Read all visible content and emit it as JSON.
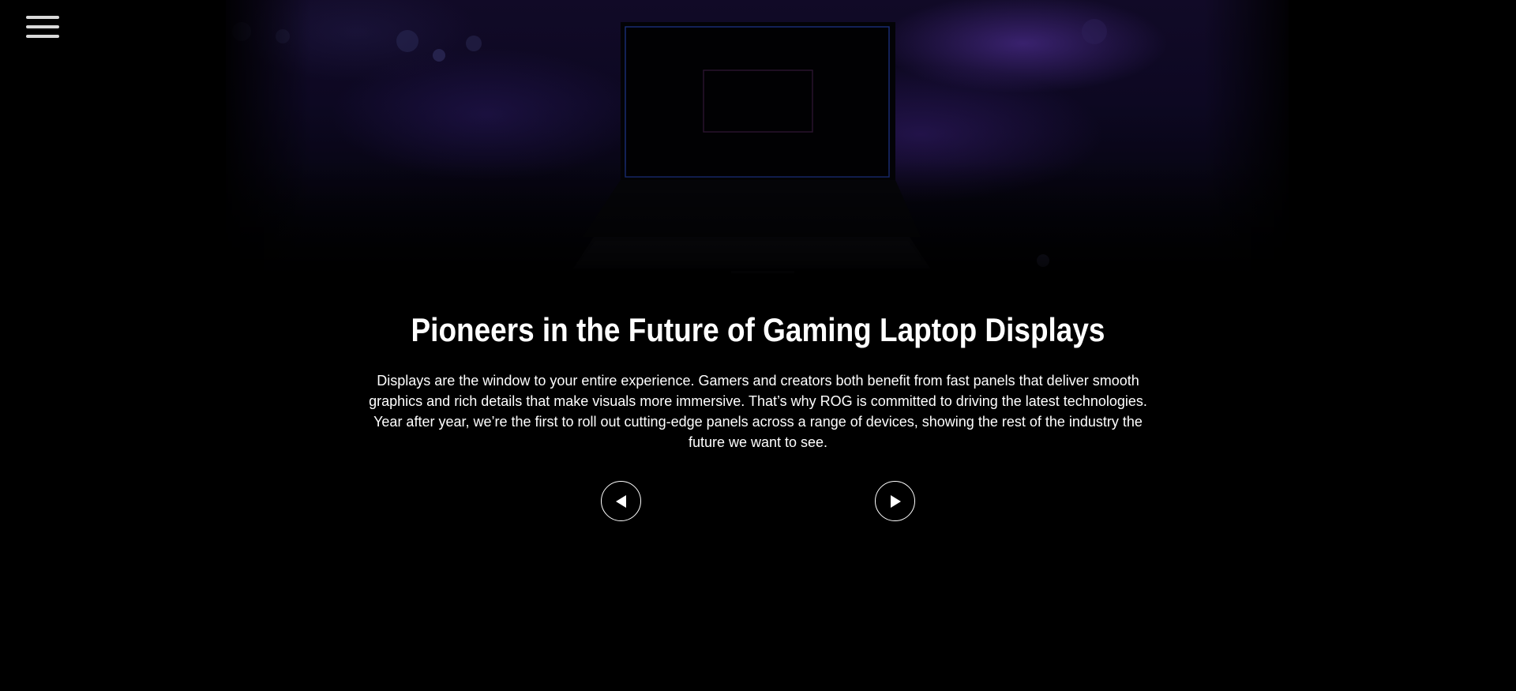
{
  "menu": {
    "icon": "hamburger-menu-icon"
  },
  "hero": {
    "image_subject": "gaming laptop silhouette",
    "accent_color": "#5a36aa"
  },
  "content": {
    "title": "Pioneers in the Future of Gaming Laptop Displays",
    "description": "Displays are the window to your entire experience. Gamers and creators both benefit from fast panels that deliver smooth graphics and rich details that make visuals more immersive. That’s why ROG is committed to driving the latest technologies. Year after year, we’re the first to roll out cutting-edge panels across a range of devices, showing the rest of the industry the future we want to see."
  },
  "carousel": {
    "prev_icon": "play-left-icon",
    "next_icon": "play-right-icon"
  },
  "colors": {
    "background": "#000000",
    "text": "#ffffff",
    "screen_outline": "#1b2f7a"
  }
}
